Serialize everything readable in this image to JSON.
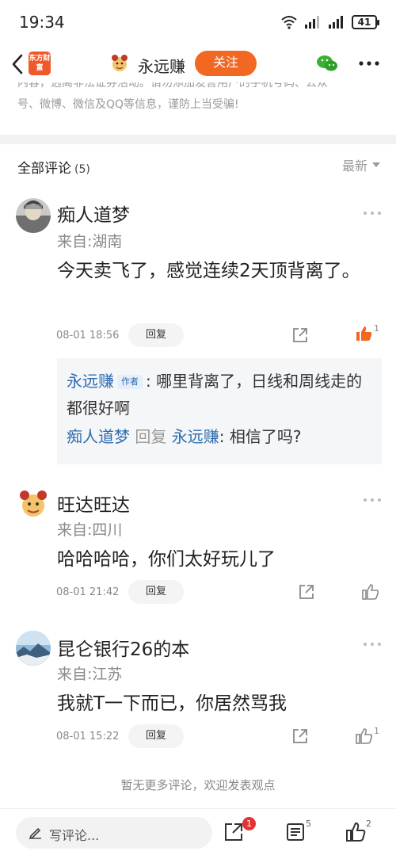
{
  "status": {
    "time": "19:34",
    "battery": "41"
  },
  "header": {
    "logo_text": "东方财富",
    "author_name": "永远赚",
    "follow_label": "关注"
  },
  "notice": {
    "line1": "内容，远离非法证券活动。请勿添加发言用户的手机号码、公众",
    "line2": "号、微博、微信及QQ等信息，谨防上当受骗!"
  },
  "comments_header": {
    "title": "全部评论",
    "count": "(5)",
    "sort": "最新"
  },
  "comments": [
    {
      "name": "痴人道梦",
      "location": "来自:湖南",
      "body": "今天卖飞了，感觉连续2天顶背离了。",
      "date": "08-01 18:56",
      "reply_label": "回复",
      "likes": "1",
      "replies": [
        {
          "name": "永远赚",
          "tag": "作者",
          "text": ": 哪里背离了，日线和周线走的都很好啊"
        },
        {
          "name": "痴人道梦",
          "verb": "回复",
          "target": "永远赚",
          "text": ": 相信了吗?"
        }
      ]
    },
    {
      "name": "旺达旺达",
      "location": "来自:四川",
      "body": "哈哈哈哈，你们太好玩儿了",
      "date": "08-01 21:42",
      "reply_label": "回复",
      "likes": ""
    },
    {
      "name": "昆仑银行26的本",
      "location": "来自:江苏",
      "body": "我就T一下而已，你居然骂我",
      "date": "08-01 15:22",
      "reply_label": "回复",
      "likes": "1"
    }
  ],
  "footer_note": "暂无更多评论，欢迎发表观点",
  "bottom_bar": {
    "write_placeholder": "写评论...",
    "share_badge": "1",
    "comment_count": "5",
    "like_count": "2"
  },
  "colors": {
    "accent": "#f26722",
    "link": "#2b6cb0",
    "badge": "#e63232"
  }
}
